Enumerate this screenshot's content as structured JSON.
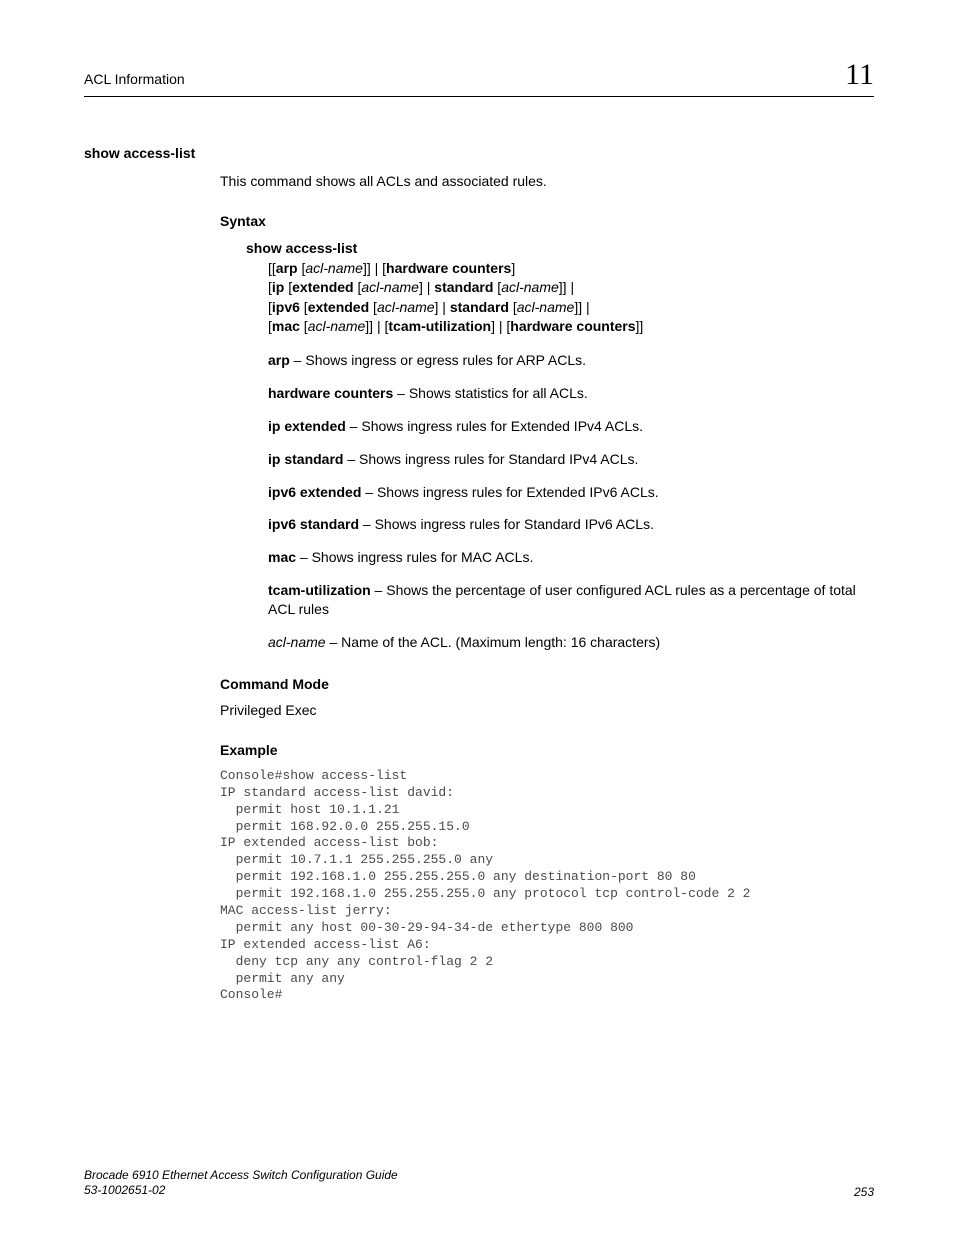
{
  "header": {
    "title": "ACL Information",
    "chapter": "11"
  },
  "command": {
    "name": "show access-list",
    "intro": "This command shows all ACLs and associated rules."
  },
  "syntax": {
    "heading": "Syntax",
    "cmd": "show access-list",
    "l1": {
      "a": "[[",
      "b": "arp",
      "c": " [",
      "d": "acl-name",
      "e": "]] | [",
      "f": "hardware counters",
      "g": "]"
    },
    "l2": {
      "a": "[",
      "b": "ip",
      "c": " [",
      "d": "extended",
      "e": " [",
      "f": "acl-name",
      "g": "] | ",
      "h": "standard",
      "i": " [",
      "j": "acl-name",
      "k": "]] |"
    },
    "l3": {
      "a": "[",
      "b": "ipv6",
      "c": " [",
      "d": "extended",
      "e": " [",
      "f": "acl-name",
      "g": "] | ",
      "h": "standard",
      "i": " [",
      "j": "acl-name",
      "k": "]] |"
    },
    "l4": {
      "a": "[",
      "b": "mac",
      "c": " [",
      "d": "acl-name",
      "e": "]] | [",
      "f": "tcam-utilization",
      "g": "] | [",
      "h": "hardware counters",
      "i": "]]"
    }
  },
  "params": {
    "p1": {
      "term": "arp",
      "desc": " – Shows ingress or egress rules for ARP ACLs."
    },
    "p2": {
      "term": "hardware counters",
      "desc": " – Shows statistics for all ACLs."
    },
    "p3": {
      "term": "ip extended",
      "desc": " – Shows ingress rules for Extended IPv4 ACLs."
    },
    "p4": {
      "term": "ip standard",
      "desc": " – Shows ingress rules for Standard IPv4 ACLs."
    },
    "p5": {
      "term": "ipv6 extended",
      "desc": " – Shows ingress rules for Extended IPv6 ACLs."
    },
    "p6": {
      "term": "ipv6 standard",
      "desc": " – Shows ingress rules for Standard IPv6 ACLs."
    },
    "p6fix": {
      "term": "ipv6 standard",
      "desc": " – Shows ingress rules for Standard IPv6 ACLs."
    },
    "p7": {
      "term": "mac",
      "desc": " – Shows ingress rules for MAC ACLs."
    },
    "p8": {
      "term": "tcam-utilization",
      "desc": " – Shows the percentage of user configured ACL rules as a percentage of total ACL rules"
    },
    "p9": {
      "term": "acl-name",
      "desc": " – Name of the ACL. (Maximum length: 16 characters)"
    }
  },
  "mode": {
    "heading": "Command Mode",
    "text": "Privileged Exec"
  },
  "example": {
    "heading": "Example",
    "text": "Console#show access-list\nIP standard access-list david:\n  permit host 10.1.1.21\n  permit 168.92.0.0 255.255.15.0\nIP extended access-list bob:\n  permit 10.7.1.1 255.255.255.0 any\n  permit 192.168.1.0 255.255.255.0 any destination-port 80 80\n  permit 192.168.1.0 255.255.255.0 any protocol tcp control-code 2 2\nMAC access-list jerry:\n  permit any host 00-30-29-94-34-de ethertype 800 800\nIP extended access-list A6:\n  deny tcp any any control-flag 2 2\n  permit any any\nConsole#"
  },
  "footer": {
    "book": "Brocade 6910 Ethernet Access Switch Configuration Guide",
    "docnum": "53-1002651-02",
    "page": "253"
  }
}
